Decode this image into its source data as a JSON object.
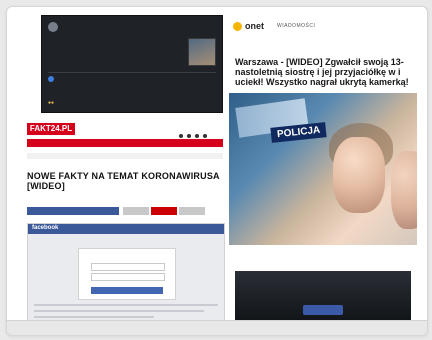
{
  "panel_onet": {
    "brand": "onet",
    "section": "WIADOMOŚCI",
    "headline": "Warszawa - [WIDEO] Zgwałcił swoją 13-nastoletnią siostrę i jej przyjaciółkę w i uciekł! Wszystko nagrał ukrytą kamerką!",
    "photo_caption": "POLICJA"
  },
  "panel_fakt": {
    "brand": "FAKT24.PL",
    "headline": "NOWE FAKTY NA TEMAT KORONAWIRUSA [WIDEO]"
  },
  "panel_facebook_login": {
    "brand": "facebook"
  },
  "colors": {
    "fakt_red": "#d6001c",
    "facebook_blue": "#3b5998",
    "onet_yellow": "#f7b500",
    "police_navy": "#10295e"
  }
}
